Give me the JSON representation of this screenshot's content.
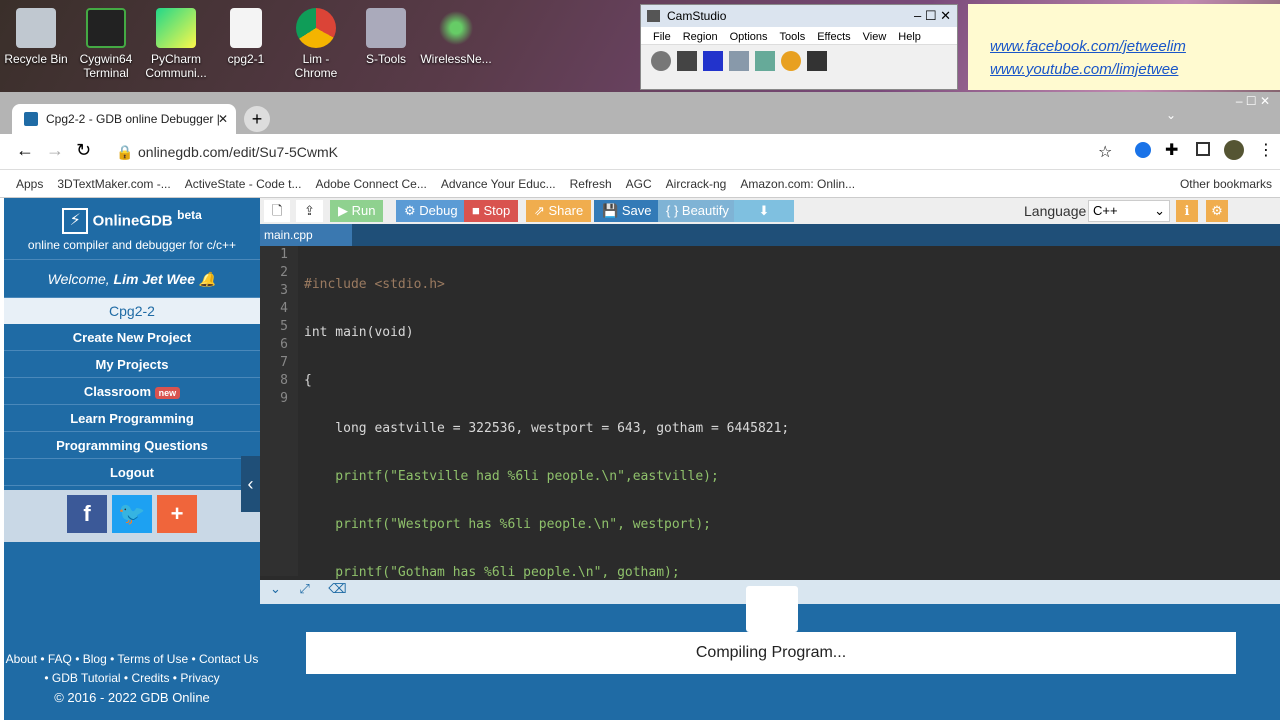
{
  "desktop": {
    "icons": [
      {
        "label": "Recycle Bin",
        "icon": "recycle-bin-icon"
      },
      {
        "label": "Cygwin64 Terminal",
        "icon": "terminal-icon"
      },
      {
        "label": "PyCharm Communi...",
        "icon": "pycharm-icon"
      },
      {
        "label": "cpg2-1",
        "icon": "file-icon"
      },
      {
        "label": "Lim - Chrome",
        "icon": "chrome-icon"
      },
      {
        "label": "S-Tools",
        "icon": "stools-icon"
      },
      {
        "label": "WirelessNe...",
        "icon": "wireless-icon"
      }
    ],
    "links": [
      "www.facebook.com/jetweelim",
      "www.youtube.com/limjetwee"
    ]
  },
  "camstudio": {
    "title": "CamStudio",
    "menu": [
      "File",
      "Region",
      "Options",
      "Tools",
      "Effects",
      "View",
      "Help"
    ]
  },
  "browser": {
    "tab_title": "Cpg2-2 - GDB online Debugger |",
    "url": "onlinegdb.com/edit/Su7-5CwmK",
    "bookmarks": [
      "Apps",
      "3DTextMaker.com -...",
      "ActiveState - Code t...",
      "Adobe Connect Ce...",
      "Advance Your Educ...",
      "Refresh",
      "AGC",
      "Aircrack-ng",
      "Amazon.com: Onlin..."
    ],
    "other_bookmarks": "Other bookmarks"
  },
  "sidebar": {
    "brand": "OnlineGDB",
    "beta": "beta",
    "tagline": "online compiler and debugger for c/c++",
    "welcome": "Welcome,",
    "user": "Lim Jet Wee",
    "active_project": "Cpg2-2",
    "nav": [
      "Create New Project",
      "My Projects",
      "Classroom",
      "Learn Programming",
      "Programming Questions",
      "Logout"
    ],
    "new_badge": "new",
    "footer_line1": "About • FAQ • Blog • Terms of Use • Contact Us",
    "footer_line2": "• GDB Tutorial • Credits • Privacy",
    "footer_line3": "© 2016 - 2022 GDB Online"
  },
  "toolbar": {
    "run": "Run",
    "debug": "Debug",
    "stop": "Stop",
    "share": "Share",
    "save": "Save",
    "beautify": "{ } Beautify",
    "language_label": "Language",
    "language_value": "C++"
  },
  "editor": {
    "filename": "main.cpp",
    "line_numbers": [
      "1",
      "2",
      "3",
      "4",
      "5",
      "6",
      "7",
      "8",
      "9"
    ],
    "lines": [
      "#include <stdio.h>",
      "int main(void)",
      "{",
      "    long eastville = 322536, westport = 643, gotham = 6445821;",
      "    printf(\"Eastville had %6li people.\\n\",eastville);",
      "    printf(\"Westport has %6li people.\\n\", westport);",
      "    printf(\"Gotham has %6li people.\\n\", gotham);",
      "}",
      ""
    ]
  },
  "output": {
    "status": "Compiling Program..."
  },
  "colors": {
    "sidebar": "#1f6ba5",
    "run_button": "#5cb85c",
    "debug_button": "#5b9bd5",
    "stop_button": "#d9534f",
    "share_button": "#f0ad4e",
    "save_button": "#337ab7",
    "beautify_button": "#7fb3d5"
  }
}
